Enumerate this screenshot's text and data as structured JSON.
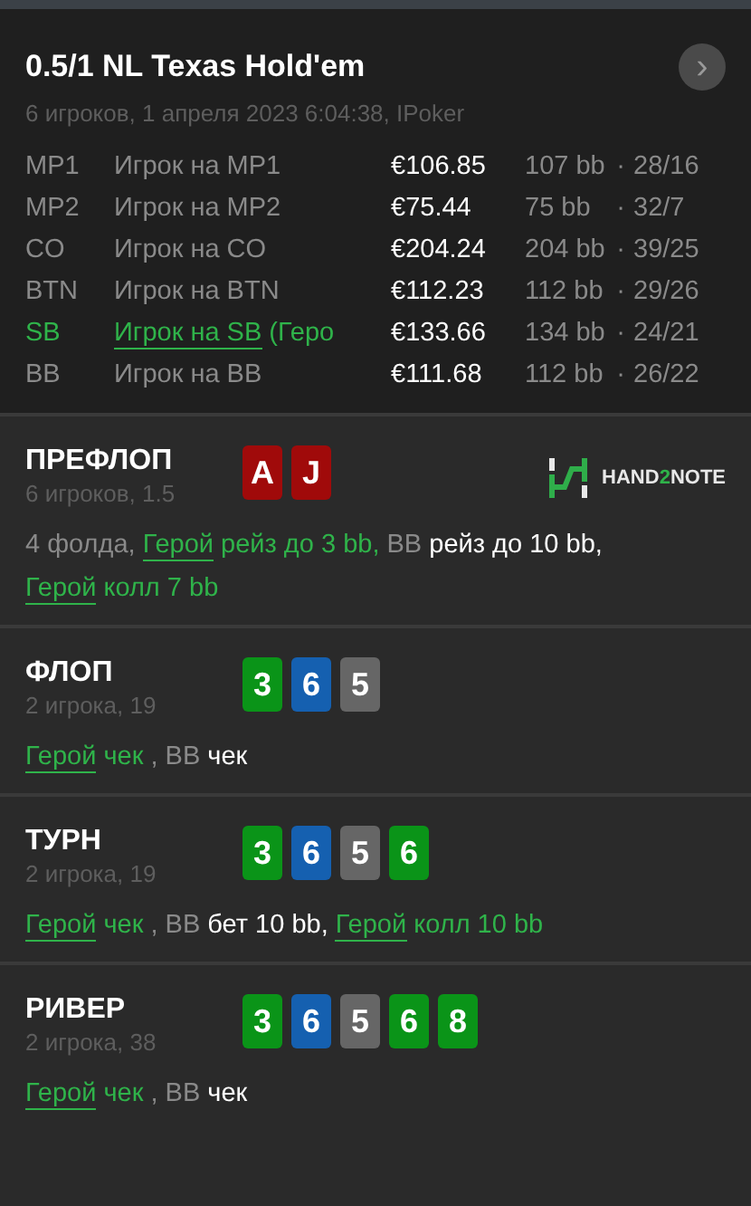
{
  "header": {
    "title": "0.5/1 NL Texas Hold'em",
    "subtitle": "6 игроков, 1 апреля 2023 6:04:38, IPoker",
    "button": "›"
  },
  "players": [
    {
      "position": "MP1",
      "name": "Игрок на MP1",
      "stack": "€106.85",
      "bb": "107 bb",
      "sep": "·",
      "stats": "28/16",
      "hero": false
    },
    {
      "position": "MP2",
      "name": "Игрок на MP2",
      "stack": "€75.44",
      "bb": "75 bb",
      "sep": "·",
      "stats": "32/7",
      "hero": false
    },
    {
      "position": "CO",
      "name": "Игрок на CO",
      "stack": "€204.24",
      "bb": "204 bb",
      "sep": "·",
      "stats": "39/25",
      "hero": false
    },
    {
      "position": "BTN",
      "name": "Игрок на BTN",
      "stack": "€112.23",
      "bb": "112 bb",
      "sep": "·",
      "stats": "29/26",
      "hero": false
    },
    {
      "position": "SB",
      "name": "Игрок на SB",
      "note": " (Геро",
      "stack": "€133.66",
      "bb": "134 bb",
      "sep": "·",
      "stats": "24/21",
      "hero": true
    },
    {
      "position": "BB",
      "name": "Игрок на BB",
      "stack": "€111.68",
      "bb": "112 bb",
      "sep": "·",
      "stats": "26/22",
      "hero": false
    }
  ],
  "streets": [
    {
      "name": "ПРЕФЛОП",
      "info": "6 игроков, 1.5",
      "logo": {
        "before": "HAND",
        "accent": "2",
        "after": "NOTE"
      },
      "cards": [
        {
          "rank": "A",
          "color": "#a00a0a"
        },
        {
          "rank": "J",
          "color": "#a00a0a"
        }
      ],
      "actions": [
        {
          "kind": "note",
          "text": "4 фолда, "
        },
        {
          "kind": "hero",
          "text": "Герой"
        },
        {
          "kind": "hero_action",
          "text": " рейз до 3 bb, "
        },
        {
          "kind": "villain",
          "text": "BB"
        },
        {
          "kind": "villain_action",
          "text": " рейз до 10 bb, "
        },
        {
          "kind": "hero",
          "text": "Герой"
        },
        {
          "kind": "hero_action",
          "text": " колл 7 bb"
        }
      ]
    },
    {
      "name": "ФЛОП",
      "info": "2 игрока, 19",
      "cards": [
        {
          "rank": "3",
          "color": "#0a9418"
        },
        {
          "rank": "6",
          "color": "#1560b0"
        },
        {
          "rank": "5",
          "color": "#666666"
        }
      ],
      "actions": [
        {
          "kind": "hero",
          "text": "Герой"
        },
        {
          "kind": "hero_action",
          "text": " чек "
        },
        {
          "kind": "note",
          "text": ", "
        },
        {
          "kind": "villain",
          "text": "BB"
        },
        {
          "kind": "villain_action",
          "text": " чек"
        }
      ]
    },
    {
      "name": "ТУРН",
      "info": "2 игрока, 19",
      "cards": [
        {
          "rank": "3",
          "color": "#0a9418"
        },
        {
          "rank": "6",
          "color": "#1560b0"
        },
        {
          "rank": "5",
          "color": "#666666"
        },
        {
          "rank": "6",
          "color": "#0a9418"
        }
      ],
      "actions": [
        {
          "kind": "hero",
          "text": "Герой"
        },
        {
          "kind": "hero_action",
          "text": " чек "
        },
        {
          "kind": "note",
          "text": ", "
        },
        {
          "kind": "villain",
          "text": "BB"
        },
        {
          "kind": "villain_action",
          "text": " бет 10 bb, "
        },
        {
          "kind": "hero",
          "text": "Герой"
        },
        {
          "kind": "hero_action",
          "text": " колл 10 bb"
        }
      ]
    },
    {
      "name": "РИВЕР",
      "info": "2 игрока, 38",
      "cards": [
        {
          "rank": "3",
          "color": "#0a9418"
        },
        {
          "rank": "6",
          "color": "#1560b0"
        },
        {
          "rank": "5",
          "color": "#666666"
        },
        {
          "rank": "6",
          "color": "#0a9418"
        },
        {
          "rank": "8",
          "color": "#0a9418"
        }
      ],
      "actions": [
        {
          "kind": "hero",
          "text": "Герой"
        },
        {
          "kind": "hero_action",
          "text": " чек "
        },
        {
          "kind": "note",
          "text": ", "
        },
        {
          "kind": "villain",
          "text": "BB"
        },
        {
          "kind": "villain_action",
          "text": " чек"
        }
      ]
    }
  ]
}
